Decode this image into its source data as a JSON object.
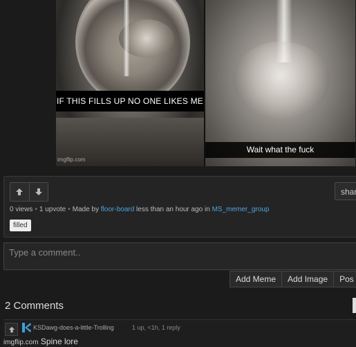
{
  "meme": {
    "top_caption": "IF THIS FILLS UP NO ONE LIKES ME",
    "bottom_caption": "Wait what the fuck",
    "watermark": "imgflip.com"
  },
  "post": {
    "share_label": "shar",
    "views": "0 views",
    "upvotes": "1 upvote",
    "made_by_prefix": "Made by",
    "author": "floor-board",
    "time": "less than an hour ago in",
    "stream": "MS_memer_group",
    "tag": "filled"
  },
  "composer": {
    "placeholder": "Type a comment..",
    "buttons": [
      "Add Meme",
      "Add Image",
      "Pos"
    ]
  },
  "comments": {
    "title": "2 Comments",
    "items": [
      {
        "username": "KSDawg-does-a-little-Trolling",
        "meta": "1 up, <1h, 1 reply",
        "text": "Spine lore",
        "overlay_watermark": "imgflip.com"
      }
    ]
  },
  "colors": {
    "link": "#4fa3d9",
    "background": "#1b1b1b",
    "avatar": "#3fa0d8"
  }
}
